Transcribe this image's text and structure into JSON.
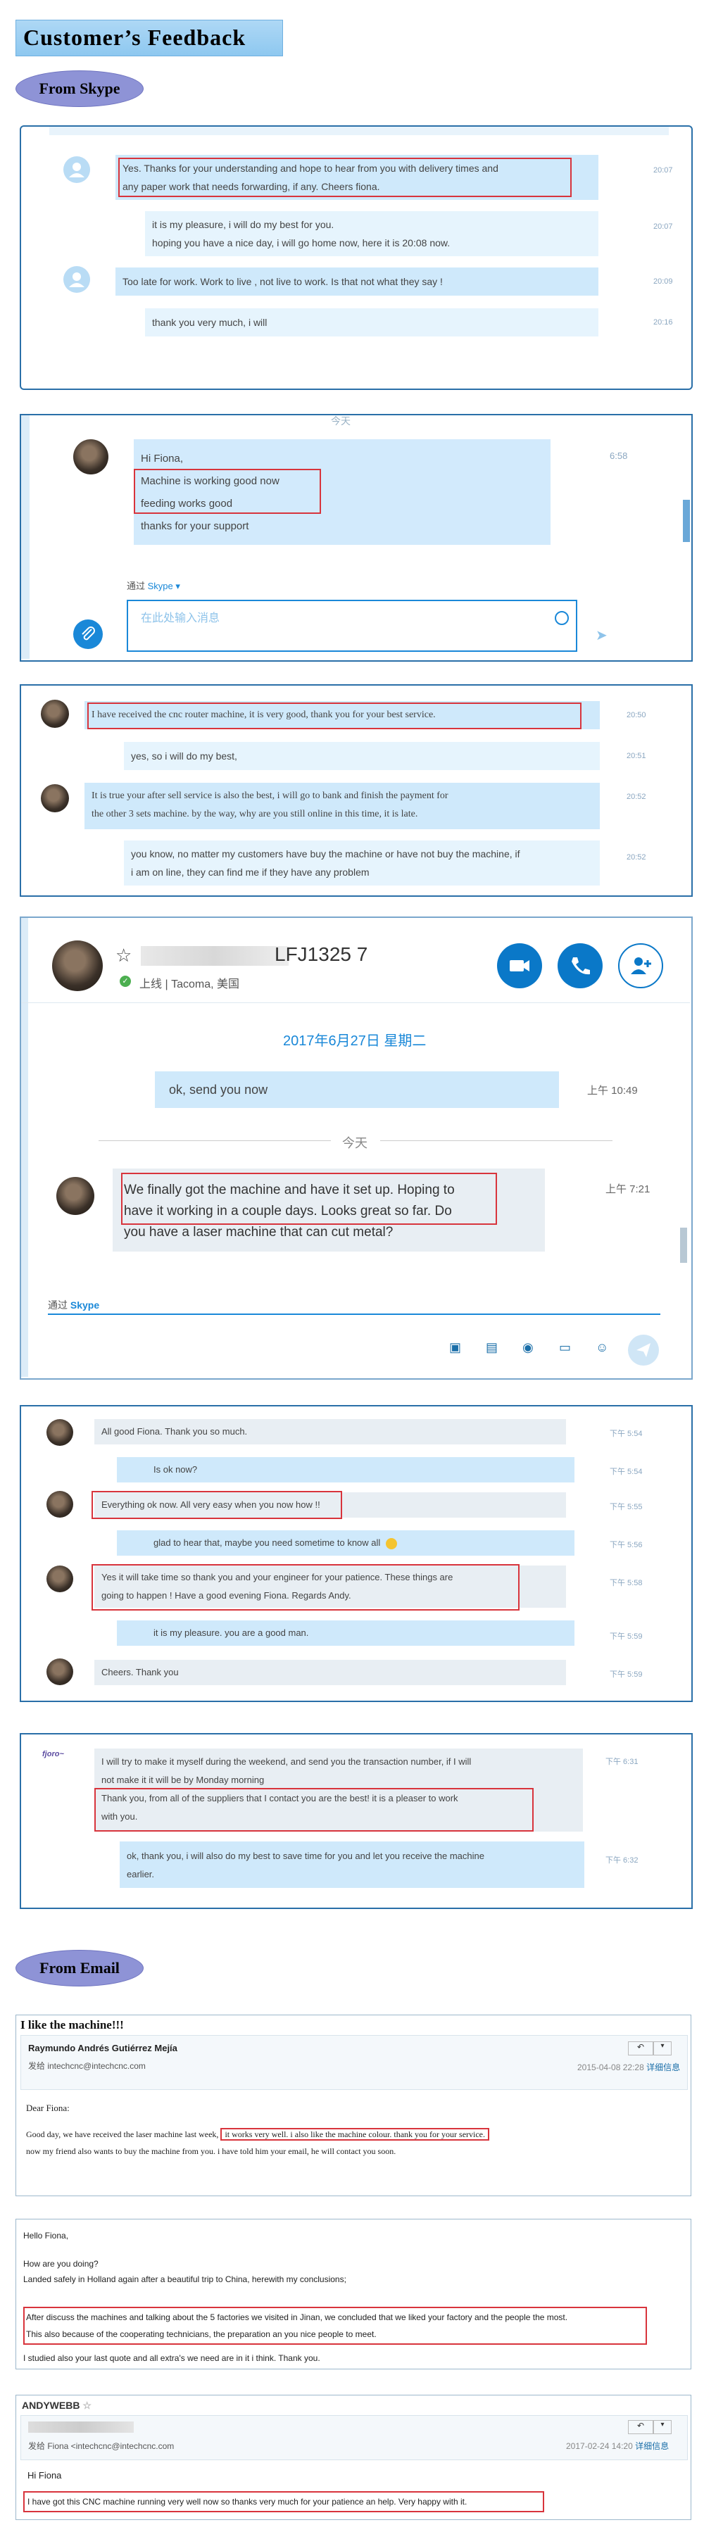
{
  "page": {
    "title": "Customer’s Feedback",
    "skype_section": "From Skype",
    "email_section": "From Email"
  },
  "chat1": {
    "messages": [
      {
        "text_l1": "Yes. Thanks for your understanding and hope to hear from you with delivery times and",
        "text_l2": "any paper work that needs forwarding, if any. Cheers fiona.",
        "time": "20:07"
      },
      {
        "text_l1": "it is my pleasure, i will do my best for you.",
        "text_l2": "hoping you have a nice day,  i will go home now, here it is 20:08 now.",
        "time": "20:07"
      },
      {
        "text_l1": "Too late for work. Work to live , not live to work.  Is that not what they say !",
        "time": "20:09"
      },
      {
        "text_l1": "thank you very much, i will",
        "time": "20:16"
      }
    ]
  },
  "chat2": {
    "today": "今天",
    "lines": [
      "Hi Fiona,",
      "Machine is working good now",
      "feeding works good",
      "thanks for your support"
    ],
    "time": "6:58",
    "via_label": "通过",
    "via_app": "Skype",
    "input_placeholder": "在此处输入消息"
  },
  "chat3": {
    "messages": [
      {
        "text_l1": "I have received the cnc router machine, it is very good, thank you for your best service.",
        "time": "20:50"
      },
      {
        "text_l1": "yes, so i will do my best,",
        "time": "20:51"
      },
      {
        "text_l1": "It is true your after sell service is also the best, i will go to bank and finish the payment for",
        "text_l2": "the other 3 sets machine. by the way, why are you still online in this time, it is late.",
        "time": "20:52"
      },
      {
        "text_l1": "you know, no matter my customers have buy the machine or have not buy the machine, if",
        "text_l2": "i am on line, they can find me if they have any problem",
        "time": "20:52"
      }
    ]
  },
  "chat4": {
    "contact_name": "LFJ1325 7",
    "status": "上线",
    "location": "Tacoma, 美国",
    "date": "2017年6月27日 星期二",
    "sent_msg": "ok, send you now",
    "sent_time": "上午 10:49",
    "today": "今天",
    "recv_l1": "We finally got the machine and have it set up. Hoping to",
    "recv_l2": "have it working in a couple days. Looks great so far. Do",
    "recv_l3": "you have a laser machine that can cut metal?",
    "recv_time": "上午 7:21",
    "via_label": "通过",
    "via_app": "Skype"
  },
  "chat5": {
    "messages": [
      {
        "text": "All good Fiona. Thank you so much.",
        "time": "下午 5:54"
      },
      {
        "text": "Is ok now?",
        "time": "下午 5:54"
      },
      {
        "text": "Everything ok now. All very easy when you now how !!",
        "time": "下午 5:55"
      },
      {
        "text": "glad to hear that, maybe you need sometime to know all",
        "time": "下午 5:56"
      },
      {
        "text_l1": "Yes it will take time so thank you and your engineer for your patience. These things are",
        "text_l2": "going to happen ! Have a good evening Fiona. Regards Andy.",
        "time": "下午 5:58"
      },
      {
        "text": "it is my pleasure. you are a good man.",
        "time": "下午 5:59"
      },
      {
        "text": "Cheers. Thank you",
        "time": "下午 5:59"
      }
    ]
  },
  "chat6": {
    "m1_l1": "I will try to make it myself during the weekend, and send you the transaction number, if I will",
    "m1_l2": "not make it it will be by Monday morning",
    "m1_l3": "Thank you, from all of the suppliers that I contact you are the best! it is a pleaser to work",
    "m1_l4": "with you.",
    "m1_time": "下午 6:31",
    "m2_l1": "ok, thank you, i will also do my best to save time for you and let you receive the machine",
    "m2_l2": "earlier.",
    "m2_time": "下午 6:32"
  },
  "email1": {
    "subject": "I like the machine!!!",
    "sender": "Raymundo Andrés Gutiérrez Mejía",
    "to": "发给 intechcnc@intechcnc.com",
    "date": "2015-04-08 22:28",
    "detail": "详细信息",
    "greeting": "Dear Fiona:",
    "body_l1a": "Good day, we have received the laser machine last week,",
    "body_l1b": "it works very well. i also like the machine colour. thank you for your service.",
    "body_l2": "now my friend also wants to buy the machine from you. i have told him your email, he will contact you soon."
  },
  "email2": {
    "l1": "Hello Fiona,",
    "l2": "How are you doing?",
    "l3": "Landed safely in Holland again after a beautiful trip to China, herewith my conclusions;",
    "l4": "After discuss the machines and talking about the 5 factories we visited in Jinan, we concluded that we liked your factory and the people the most.",
    "l5": "This also because of the cooperating technicians, the preparation an you nice people to meet.",
    "l6": "I studied also your last quote and all extra's we need are in it i think. Thank you."
  },
  "email3": {
    "sender": "ANDYWEBB",
    "to": "发给 Fiona <intechcnc@intechcnc.com",
    "date": "2017-02-24 14:20",
    "detail": "详细信息",
    "greeting": "Hi Fiona",
    "body": "I have got this CNC machine running very well now so thanks very much for your patience an help. Very happy with it."
  },
  "colors": {
    "accent": "#1a88d8",
    "bubble": "#cfe9fb",
    "highlight": "#d8343c",
    "panel_border": "#2a6fa8"
  }
}
